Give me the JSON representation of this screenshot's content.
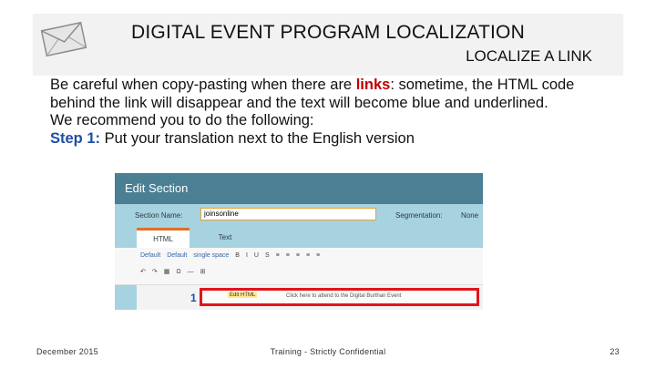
{
  "slide": {
    "title": "DIGITAL EVENT PROGRAM LOCALIZATION",
    "subtitle": "LOCALIZE A LINK",
    "intro_before": "Be careful when copy-pasting when there are ",
    "intro_keyword": "links",
    "intro_after": ": sometime, the HTML code behind the link will disappear and the text will become blue and underlined.",
    "recommend": "We recommend you to do the following:",
    "step_label": "Step 1:",
    "step_text": " Put your translation next to the English version"
  },
  "screenshot": {
    "panel_title": "Edit Section",
    "section_name_label": "Section Name:",
    "section_name_value": "joinsonline",
    "segmentation_label": "Segmentation:",
    "segmentation_value": "None",
    "tab_html": "HTML",
    "tab_text": "Text",
    "toolbar_row1": [
      "Default",
      "Default",
      "single space",
      "B",
      "I",
      "U",
      "S",
      "≡",
      "≡",
      "≡",
      "≡",
      "≡"
    ],
    "toolbar_row2": [
      "↶",
      "↷",
      "▦",
      "Ω",
      "—",
      "⊞"
    ],
    "edit_html_label": "Edit HTML",
    "link_text": "Click here to attend to the Digital Burthan Event",
    "step_number": "1"
  },
  "footer": {
    "date": "December 2015",
    "center": "Training - Strictly Confidential",
    "page": "23"
  },
  "colors": {
    "header_bg": "#f2f2f2",
    "keyword_red": "#c00000",
    "keyword_blue": "#1f4ea8",
    "panel_title_bg": "#4a7f94",
    "panel_bg": "#a7d2df",
    "highlight_box": "#e1141b"
  },
  "icons": {
    "header": "envelope-icon"
  }
}
